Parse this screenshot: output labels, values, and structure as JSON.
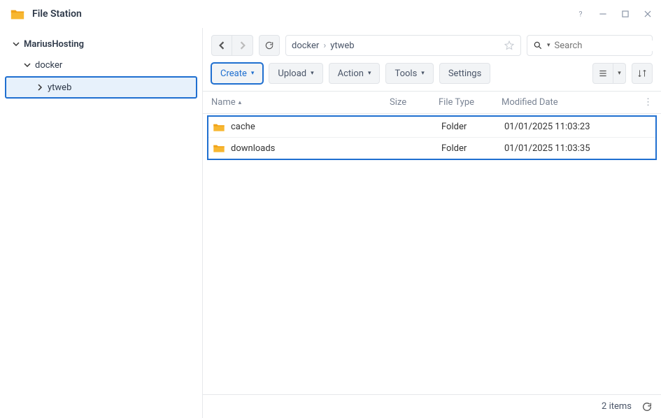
{
  "app": {
    "title": "File Station"
  },
  "tree": {
    "root": "MariusHosting",
    "lvl1": "docker",
    "lvl2": "ytweb"
  },
  "breadcrumb": {
    "part1": "docker",
    "part2": "ytweb"
  },
  "search": {
    "placeholder": "Search"
  },
  "toolbar": {
    "create": "Create",
    "upload": "Upload",
    "action": "Action",
    "tools": "Tools",
    "settings": "Settings"
  },
  "columns": {
    "name": "Name",
    "size": "Size",
    "type": "File Type",
    "date": "Modified Date"
  },
  "rows": [
    {
      "name": "cache",
      "size": "",
      "type": "Folder",
      "date": "01/01/2025 11:03:23"
    },
    {
      "name": "downloads",
      "size": "",
      "type": "Folder",
      "date": "01/01/2025 11:03:35"
    }
  ],
  "status": {
    "count": "2 items"
  }
}
